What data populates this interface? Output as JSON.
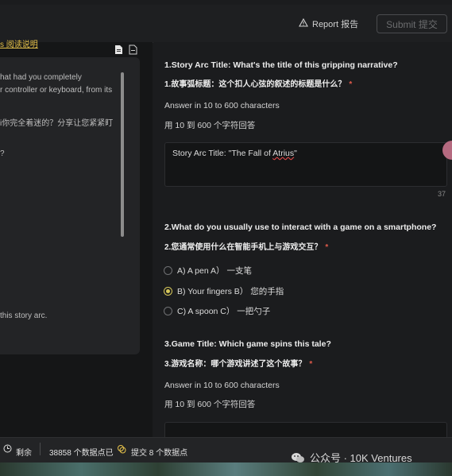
{
  "header": {
    "report_label": "Report 报告",
    "submit_label": "Submit 提交"
  },
  "sidebar": {
    "guide_link": "s 阅读说明",
    "card_lines": [
      "hat had you completely",
      "r controller or keyboard, from its",
      "i你完全着迷的？分享让您紧紧盯",
      "?",
      "this story arc."
    ]
  },
  "questions": [
    {
      "title_en": "1.Story Arc Title: What's the title of this gripping narrative?",
      "title_zh": "1.故事弧标题：这个扣人心弦的叙述的标题是什么？",
      "required_mark": "*",
      "hint_en": "Answer in 10 to 600 characters",
      "hint_zh": "用 10 到 600 个字符回答",
      "answer_prefix": "Story Arc Title: \"The Fall of ",
      "answer_flagged": "Atrius",
      "answer_suffix": "\"",
      "char_count": "37"
    },
    {
      "title_en": "2.What do you usually use to interact with a game on a smartphone?",
      "title_zh": "2.您通常使用什么在智能手机上与游戏交互？",
      "required_mark": "*",
      "options": [
        {
          "label": "A) A pen  A） 一支笔",
          "selected": false
        },
        {
          "label": "B) Your fingers  B） 您的手指",
          "selected": true
        },
        {
          "label": "C) A spoon  C） 一把勺子",
          "selected": false
        }
      ]
    },
    {
      "title_en": "3.Game Title: Which game spins this tale?",
      "title_zh": "3.游戏名称：哪个游戏讲述了这个故事？",
      "required_mark": "*",
      "hint_en": "Answer in 10 to 600 characters",
      "hint_zh": "用 10 到 600 个字符回答"
    }
  ],
  "footer": {
    "remaining_label": "剩余",
    "datapoints_text": "38858 个数据点已",
    "submit_count_text": "提交 8 个数据点"
  },
  "watermark": "公众号 · 10K Ventures"
}
